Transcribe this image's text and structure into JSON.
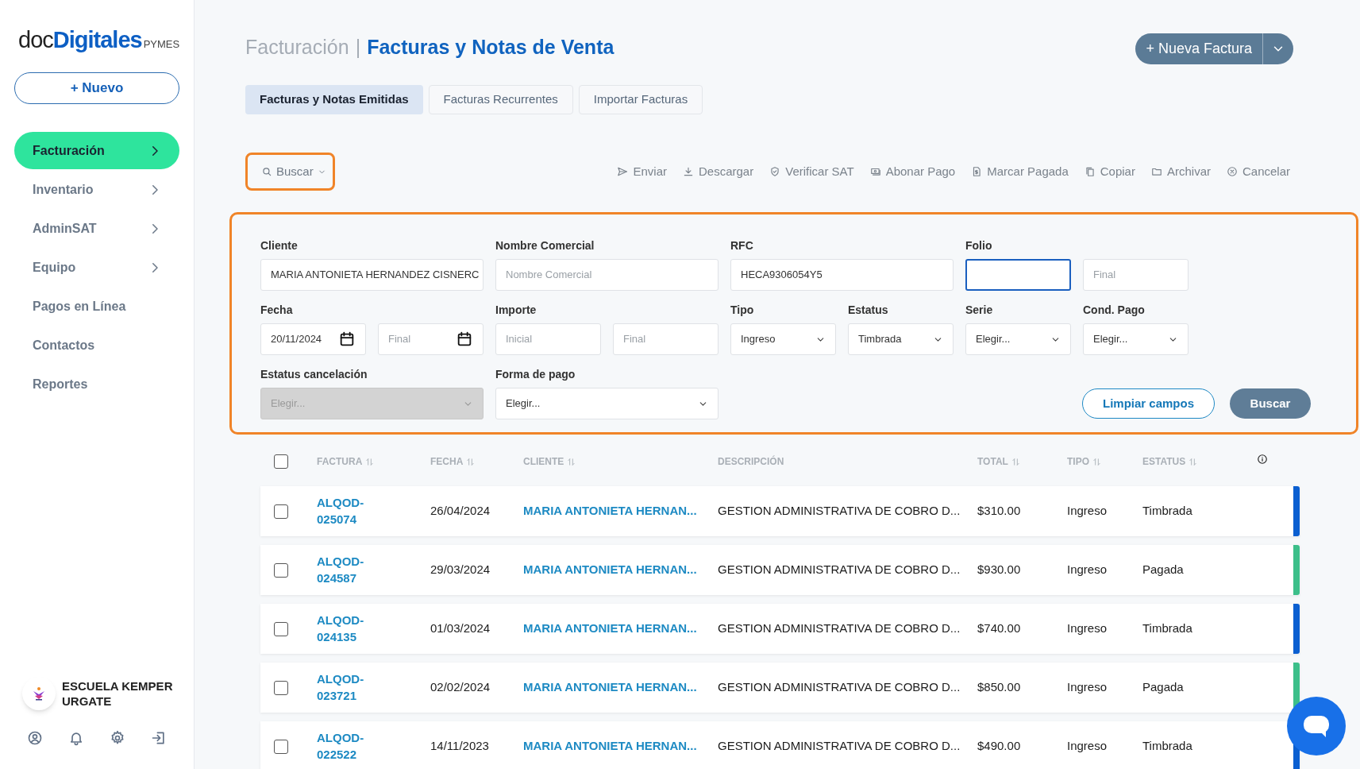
{
  "sidebar": {
    "logo": {
      "part_1": "doc",
      "part_2": "Digitales",
      "part_3": "PYMES"
    },
    "new_button": "+ Nuevo",
    "items": [
      {
        "label": "Facturación",
        "selected": true,
        "expandable": true
      },
      {
        "label": "Inventario",
        "selected": false,
        "expandable": true
      },
      {
        "label": "AdminSAT",
        "selected": false,
        "expandable": true
      },
      {
        "label": "Equipo",
        "selected": false,
        "expandable": true
      },
      {
        "label": "Pagos en Línea",
        "selected": false,
        "expandable": false
      },
      {
        "label": "Contactos",
        "selected": false,
        "expandable": false
      },
      {
        "label": "Reportes",
        "selected": false,
        "expandable": false
      }
    ],
    "account": {
      "name": "ESCUELA KEMPER URGATE"
    }
  },
  "header": {
    "section": "Facturación",
    "separator": "|",
    "title": "Facturas y Notas de Venta",
    "new_button": "+ Nueva Factura"
  },
  "tabs": [
    {
      "label": "Facturas y Notas Emitidas",
      "selected": true
    },
    {
      "label": "Facturas Recurrentes",
      "selected": false
    },
    {
      "label": "Importar Facturas",
      "selected": false
    }
  ],
  "toolbar": {
    "search_button": {
      "label": "Buscar",
      "highlighted": true
    },
    "actions": [
      "Enviar",
      "Descargar",
      "Verificar SAT",
      "Abonar Pago",
      "Marcar Pagada",
      "Copiar",
      "Archivar",
      "Cancelar"
    ]
  },
  "filters": {
    "highlighted": true,
    "fields": [
      {
        "label": "Cliente",
        "inputs": [
          {
            "kind": "text",
            "value": "MARIA ANTONIETA HERNANDEZ CISNERC",
            "focused": false,
            "disabled": false
          }
        ]
      },
      {
        "label": "Nombre Comercial",
        "inputs": [
          {
            "kind": "text",
            "placeholder": "Nombre Comercial",
            "focused": false,
            "disabled": false
          }
        ]
      },
      {
        "label": "RFC",
        "inputs": [
          {
            "kind": "text",
            "value": "HECA9306054Y5",
            "focused": false,
            "disabled": false
          }
        ]
      },
      {
        "label": "Folio",
        "inputs": [
          {
            "kind": "text",
            "focused": true,
            "disabled": false
          },
          {
            "kind": "text",
            "placeholder": "Final",
            "focused": false,
            "disabled": false
          }
        ]
      },
      {
        "label": "Fecha",
        "inputs": [
          {
            "kind": "date",
            "value": "20/11/2024",
            "focused": false,
            "disabled": false
          },
          {
            "kind": "date",
            "placeholder": "Final",
            "focused": false,
            "disabled": false
          }
        ]
      },
      {
        "label": "Importe",
        "inputs": [
          {
            "kind": "text",
            "placeholder": "Inicial",
            "focused": false,
            "disabled": false
          },
          {
            "kind": "text",
            "placeholder": "Final",
            "focused": false,
            "disabled": false
          }
        ]
      },
      {
        "label": "Tipo",
        "inputs": [
          {
            "kind": "select",
            "value": "Ingreso",
            "focused": false,
            "disabled": false
          }
        ]
      },
      {
        "label": "Estatus",
        "inputs": [
          {
            "kind": "select",
            "value": "Timbrada",
            "focused": false,
            "disabled": false
          }
        ]
      },
      {
        "label": "Serie",
        "inputs": [
          {
            "kind": "select",
            "value": "Elegir...",
            "focused": false,
            "disabled": false
          }
        ]
      },
      {
        "label": "Cond. Pago",
        "inputs": [
          {
            "kind": "select",
            "value": "Elegir...",
            "focused": false,
            "disabled": false
          }
        ]
      },
      {
        "label": "Estatus cancelación",
        "inputs": [
          {
            "kind": "dropdown",
            "value": "Elegir...",
            "focused": false,
            "disabled": true
          }
        ]
      },
      {
        "label": "Forma de pago",
        "inputs": [
          {
            "kind": "dropdown",
            "value": "Elegir...",
            "focused": false,
            "disabled": false
          }
        ]
      }
    ],
    "clear_button": "Limpiar campos",
    "search_button": "Buscar"
  },
  "table": {
    "select_all_checked": false,
    "columns": [
      {
        "label": "FACTURA",
        "sortable": true
      },
      {
        "label": "FECHA",
        "sortable": true
      },
      {
        "label": "CLIENTE",
        "sortable": true
      },
      {
        "label": "DESCRIPCIÓN",
        "sortable": false
      },
      {
        "label": "TOTAL",
        "sortable": true
      },
      {
        "label": "TIPO",
        "sortable": true
      },
      {
        "label": "ESTATUS",
        "sortable": true
      }
    ],
    "rows": [
      {
        "checked": false,
        "factura": "ALQOD-025074",
        "fecha": "26/04/2024",
        "cliente": "MARIA ANTONIETA HERNAN...",
        "descripcion": "GESTION ADMINISTRATIVA DE COBRO D...",
        "total": "$310.00",
        "tipo": "Ingreso",
        "estatus": "Timbrada",
        "color": "#0b5fd1"
      },
      {
        "checked": false,
        "factura": "ALQOD-024587",
        "fecha": "29/03/2024",
        "cliente": "MARIA ANTONIETA HERNAN...",
        "descripcion": "GESTION ADMINISTRATIVA DE COBRO D...",
        "total": "$930.00",
        "tipo": "Ingreso",
        "estatus": "Pagada",
        "color": "#3cbf8a"
      },
      {
        "checked": false,
        "factura": "ALQOD-024135",
        "fecha": "01/03/2024",
        "cliente": "MARIA ANTONIETA HERNAN...",
        "descripcion": "GESTION ADMINISTRATIVA DE COBRO D...",
        "total": "$740.00",
        "tipo": "Ingreso",
        "estatus": "Timbrada",
        "color": "#0b5fd1"
      },
      {
        "checked": false,
        "factura": "ALQOD-023721",
        "fecha": "02/02/2024",
        "cliente": "MARIA ANTONIETA HERNAN...",
        "descripcion": "GESTION ADMINISTRATIVA DE COBRO D...",
        "total": "$850.00",
        "tipo": "Ingreso",
        "estatus": "Pagada",
        "color": "#3cbf8a"
      },
      {
        "checked": false,
        "factura": "ALQOD-022522",
        "fecha": "14/11/2023",
        "cliente": "MARIA ANTONIETA HERNAN...",
        "descripcion": "GESTION ADMINISTRATIVA DE COBRO D...",
        "total": "$490.00",
        "tipo": "Ingreso",
        "estatus": "Timbrada",
        "color": "#0b5fd1"
      }
    ]
  }
}
